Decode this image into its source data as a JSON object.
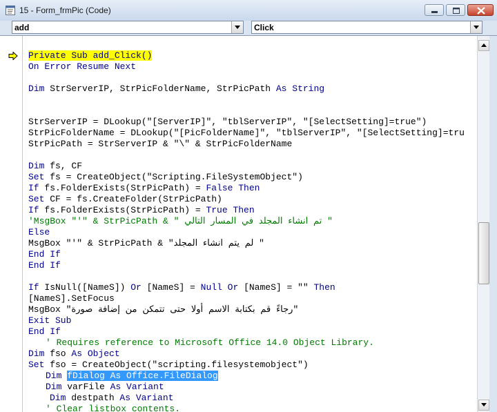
{
  "window": {
    "title": "15 - Form_frmPic (Code)"
  },
  "controls": {
    "minimize": "minimize",
    "maximize": "maximize",
    "close": "close"
  },
  "object_combo": {
    "value": "add"
  },
  "procedure_combo": {
    "value": "Click"
  },
  "colors": {
    "keyword": "#00008b",
    "comment": "#007a00",
    "execution_highlight": "#ffff00",
    "selection": "#3399ff"
  },
  "code": {
    "l01": "Private Sub add_Click()",
    "l02a": "On Error Resume Next",
    "l03a": "Dim",
    "l03b": " StrServerIP, StrPicFolderName, StrPicPath ",
    "l03c": "As String",
    "l04": "StrServerIP = DLookup(\"[ServerIP]\", \"tblServerIP\", \"[SelectSetting]=true\")",
    "l05": "StrPicFolderName = DLookup(\"[PicFolderName]\", \"tblServerIP\", \"[SelectSetting]=tru",
    "l06": "StrPicPath = StrServerIP & \"\\\" & StrPicFolderName",
    "l07a": "Dim",
    "l07b": " fs, CF",
    "l08a": "Set",
    "l08b": " fs = CreateObject(\"Scripting.FileSystemObject\")",
    "l09a": "If",
    "l09b": " fs.FolderExists(StrPicPath) = ",
    "l09c": "False Then",
    "l10a": "Set",
    "l10b": " CF = fs.CreateFolder(StrPicPath)",
    "l11a": "If",
    "l11b": " fs.FolderExists(StrPicPath) = ",
    "l11c": "True Then",
    "l12": "'MsgBox \"'\" & StrPicPath & \" تم انشاء المجلد في المسار التالي \"",
    "l13": "Else",
    "l14": "MsgBox \"'\" & StrPicPath & \"لم يتم انشاء المجلد \"",
    "l15": "End If",
    "l16": "End If",
    "l17a": "If",
    "l17b": " IsNull([NameS]) ",
    "l17c": "Or",
    "l17d": " [NameS] = ",
    "l17e": "Null Or",
    "l17f": " [NameS] = \"\" ",
    "l17g": "Then",
    "l18": "[NameS].SetFocus",
    "l19": "MsgBox \"رجاءً قم بكتابة الاسم أولا حتى تتمكن من إضافة صورة\"",
    "l20": "Exit Sub",
    "l21": "End If",
    "l22": "' Requires reference to Microsoft Office 14.0 Object Library.",
    "l23a": "Dim",
    "l23b": " fso ",
    "l23c": "As Object",
    "l24a": "Set",
    "l24b": " fso = CreateObject(\"scripting.filesystemobject\")",
    "l25a": "Dim ",
    "l25b": "fDialog As Office.FileDialog",
    "l26a": "Dim",
    "l26b": " varFile ",
    "l26c": "As Variant",
    "l27a": "Dim",
    "l27b": " destpath ",
    "l27c": "As Variant",
    "l28": "' Clear listbox contents."
  }
}
